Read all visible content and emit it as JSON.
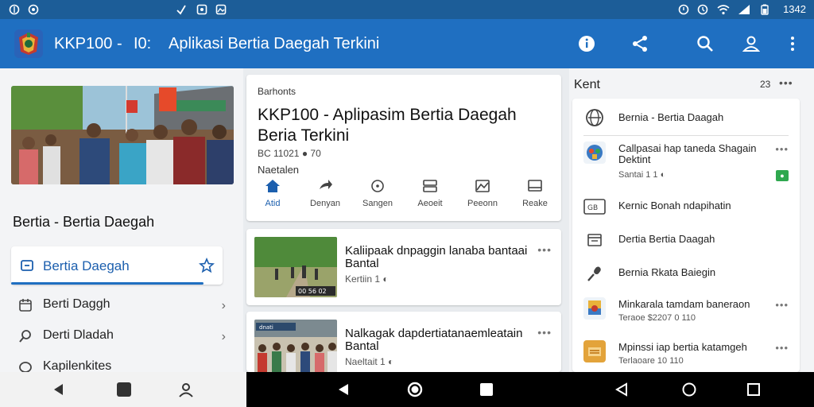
{
  "status_bar": {
    "time": "1342"
  },
  "app_bar": {
    "title": "KKP100 -",
    "title_extra": "I0:",
    "subtitle": "Aplikasi Bertia Daegah Terkini"
  },
  "left": {
    "section_title": "Bertia - Bertia Daegah",
    "active_item": {
      "label": "Bertia Daegah"
    },
    "items": [
      {
        "label": "Berti Daggh"
      },
      {
        "label": "Derti Dladah"
      },
      {
        "label": "Kapilenkites"
      }
    ]
  },
  "featured": {
    "breadcrumb": "Barhonts",
    "title": "KKP100 - Aplipasim Bertia Daegah Beria Terkini",
    "meta": "BC 11021 ● 70",
    "source": "Naetalen",
    "tabs": [
      {
        "label": "Atid",
        "icon": "home-icon",
        "active": true
      },
      {
        "label": "Denyan",
        "icon": "share-icon",
        "active": false
      },
      {
        "label": "Sangen",
        "icon": "info-icon",
        "active": false
      },
      {
        "label": "Aeoeit",
        "icon": "grid-icon",
        "active": false
      },
      {
        "label": "Peeonn",
        "icon": "image-icon",
        "active": false
      },
      {
        "label": "Reake",
        "icon": "window-icon",
        "active": false
      }
    ]
  },
  "stories": [
    {
      "title": "Kaliipaak dnpaggin lanaba bantaai Bantal",
      "meta": "Kertiin 1 ◐",
      "thumb_caption": "00 56 02"
    },
    {
      "title": "Nalkagak dapdertiatanaemleatain Bantal",
      "meta": "Naeltait 1 ◐",
      "thumb_caption": "dnati"
    }
  ],
  "right": {
    "title": "Kent",
    "count": "23",
    "items": [
      {
        "label": "Bernia - Bertia Daagah",
        "sub": "",
        "icon": "globe-icon"
      },
      {
        "label": "Callpasai hap taneda Shagain Dektint",
        "sub": "Santai 1 1 ◐",
        "icon": "app-icon"
      },
      {
        "label": "Kernic Bonah ndapihatin",
        "sub": "",
        "icon": "news-icon"
      },
      {
        "label": "Dertia Bertia Daagah",
        "sub": "",
        "icon": "calendar-icon"
      },
      {
        "label": "Bernia Rkata Baiegin",
        "sub": "",
        "icon": "mic-icon"
      },
      {
        "label": "Minkarala tamdam baneraon",
        "sub": "Teraoe $2207 0 110",
        "icon": "flag-icon"
      },
      {
        "label": "Mpinssi iap bertia katamgeh",
        "sub": "Terlaoare 10 110",
        "icon": "folder-icon"
      }
    ]
  },
  "colors": {
    "primary": "#1f6fc1",
    "status": "#1c5d98",
    "accent": "#1c5fae",
    "badge_green": "#2fa84f",
    "folder": "#e3a33a"
  }
}
